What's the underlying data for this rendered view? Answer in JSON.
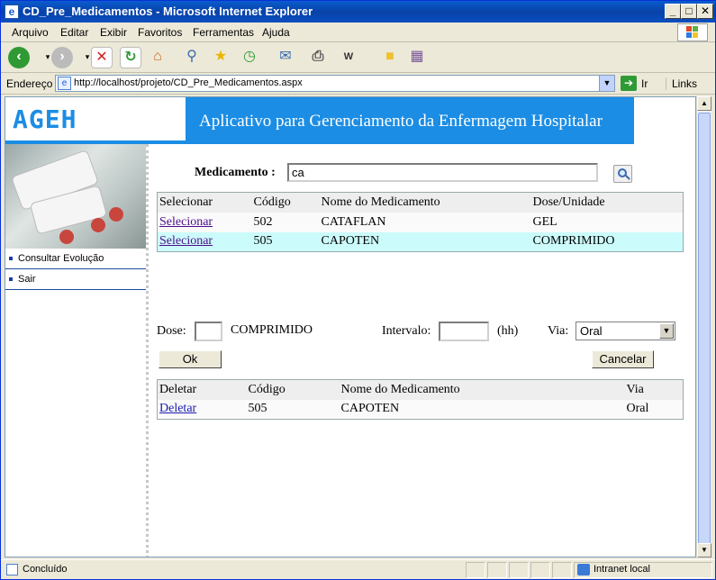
{
  "window": {
    "title": "CD_Pre_Medicamentos - Microsoft Internet Explorer"
  },
  "menu": [
    "Arquivo",
    "Editar",
    "Exibir",
    "Favoritos",
    "Ferramentas",
    "Ajuda"
  ],
  "address": {
    "label": "Endereço",
    "url": "http://localhost/projeto/CD_Pre_Medicamentos.aspx",
    "go": "Ir",
    "links": "Links"
  },
  "toolbar_icons": [
    "back-icon",
    "forward-icon",
    "stop-icon",
    "refresh-icon",
    "home-icon",
    "search-icon",
    "favorites-icon",
    "history-icon",
    "mail-icon",
    "print-icon",
    "edit-icon",
    "discuss-icon",
    "research-icon"
  ],
  "page": {
    "logo": "AGEH",
    "banner_title": "Aplicativo para Gerenciamento da Enfermagem Hospitalar",
    "sidebar": {
      "items": [
        "Consultar Evolução",
        "Sair"
      ]
    },
    "search": {
      "label": "Medicamento :",
      "value": "ca"
    },
    "results": {
      "headers": [
        "Selecionar",
        "Código",
        "Nome do Medicamento",
        "Dose/Unidade"
      ],
      "rows": [
        {
          "action": "Selecionar",
          "codigo": "502",
          "nome": "CATAFLAN",
          "dose": "GEL"
        },
        {
          "action": "Selecionar",
          "codigo": "505",
          "nome": "CAPOTEN",
          "dose": "COMPRIMIDO"
        }
      ]
    },
    "form": {
      "dose_label": "Dose:",
      "dose_value": "",
      "dose_unit": "COMPRIMIDO",
      "intervalo_label": "Intervalo:",
      "intervalo_value": "",
      "intervalo_unit": "(hh)",
      "via_label": "Via:",
      "via_selected": "Oral",
      "ok_label": "Ok",
      "cancel_label": "Cancelar"
    },
    "prescribed": {
      "headers": [
        "Deletar",
        "Código",
        "Nome do Medicamento",
        "Via"
      ],
      "rows": [
        {
          "action": "Deletar",
          "codigo": "505",
          "nome": "CAPOTEN",
          "via": "Oral"
        }
      ]
    }
  },
  "status": {
    "text": "Concluído",
    "zone": "Intranet local"
  },
  "colors": {
    "banner": "#1c8de4",
    "titlebar": "#0a5ccf",
    "selected_row": "#ccfbfb"
  }
}
